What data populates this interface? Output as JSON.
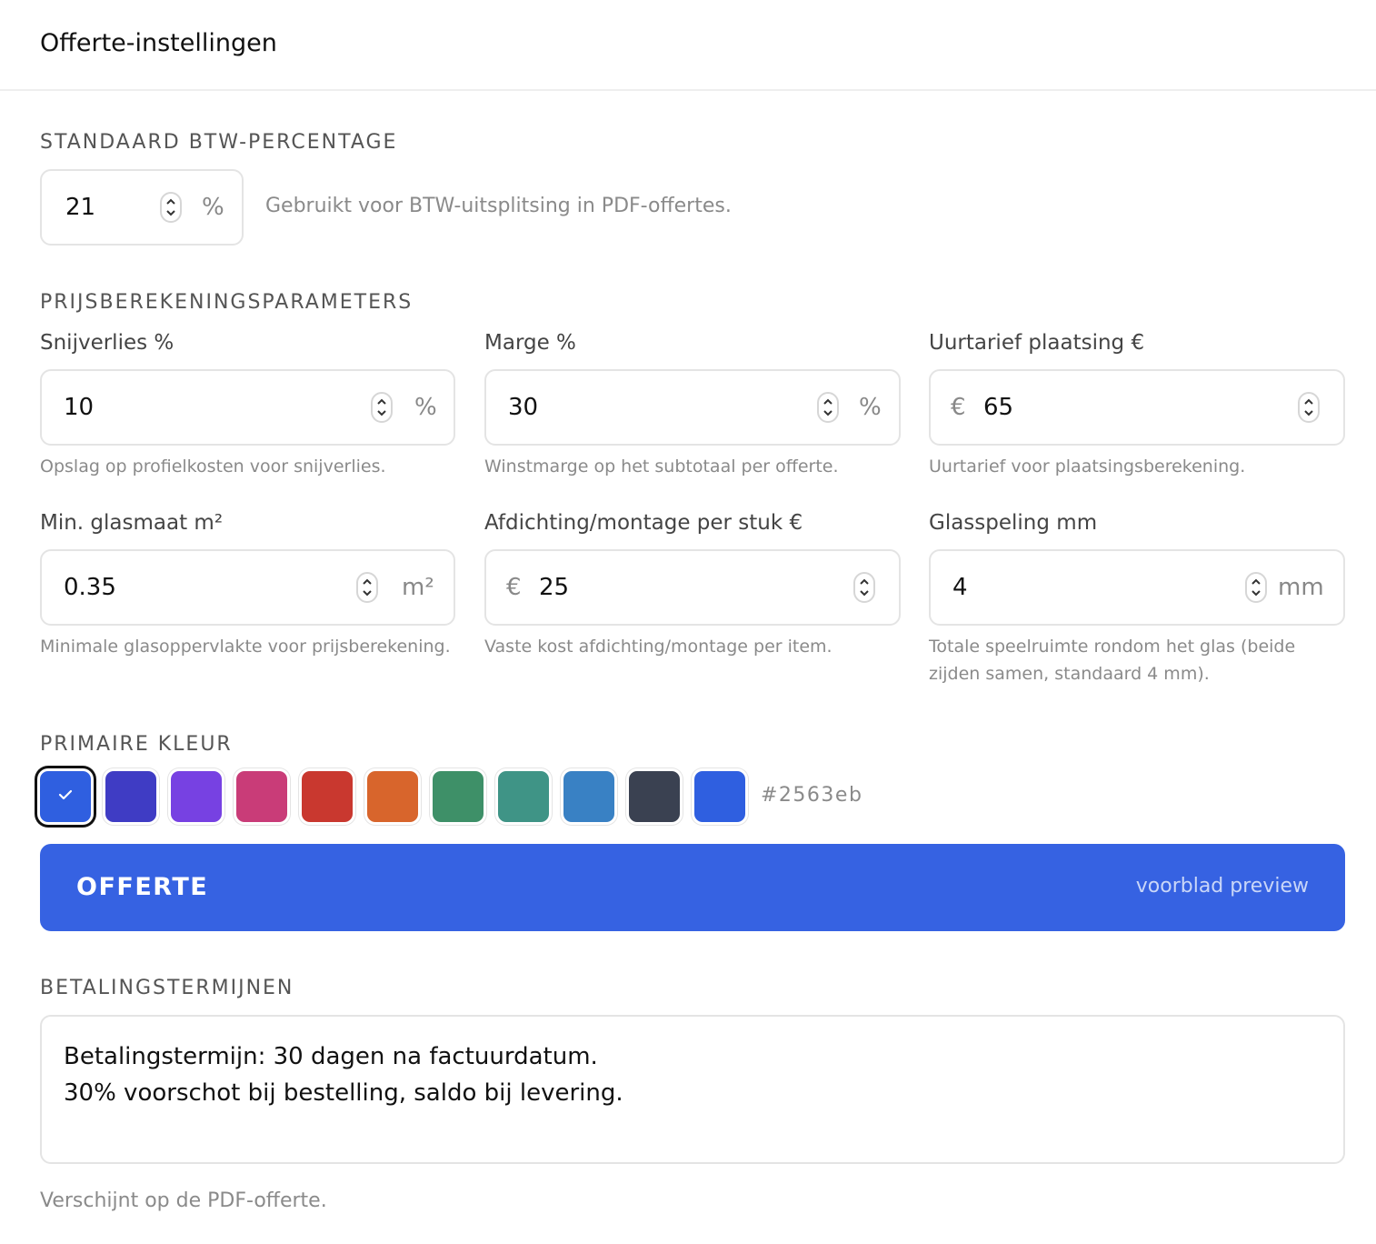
{
  "header": {
    "title": "Offerte-instellingen"
  },
  "btw": {
    "section_title": "STANDAARD BTW-PERCENTAGE",
    "value": "21",
    "suffix": "%",
    "hint": "Gebruikt voor BTW-uitsplitsing in PDF-offertes."
  },
  "pricing": {
    "section_title": "PRIJSBEREKENINGSPARAMETERS",
    "fields": [
      {
        "label": "Snijverlies %",
        "prefix": "",
        "value": "10",
        "suffix": "%",
        "hint": "Opslag op profielkosten voor snijverlies."
      },
      {
        "label": "Marge %",
        "prefix": "",
        "value": "30",
        "suffix": "%",
        "hint": "Winstmarge op het subtotaal per offerte."
      },
      {
        "label": "Uurtarief plaatsing €",
        "prefix": "€",
        "value": "65",
        "suffix": "",
        "hint": "Uurtarief voor plaatsingsberekening."
      },
      {
        "label": "Min. glasmaat m²",
        "prefix": "",
        "value": "0.35",
        "suffix": "m²",
        "hint": "Minimale glasoppervlakte voor prijsberekening."
      },
      {
        "label": "Afdichting/montage per stuk €",
        "prefix": "€",
        "value": "25",
        "suffix": "",
        "hint": "Vaste kost afdichting/montage per item."
      },
      {
        "label": "Glasspeling mm",
        "prefix": "",
        "value": "4",
        "suffix": "mm",
        "hint": "Totale speelruimte rondom het glas (beide zijden samen, standaard 4 mm)."
      }
    ]
  },
  "color": {
    "section_title": "PRIMAIRE KLEUR",
    "swatches": [
      "#2f5fe0",
      "#3f3cc4",
      "#7741e2",
      "#c93c78",
      "#c9382f",
      "#d8652c",
      "#3e9068",
      "#3f9486",
      "#3981c4",
      "#3a4151",
      "#2f5fe0"
    ],
    "selected_index": 0,
    "hex_value": "#2563eb"
  },
  "preview": {
    "title": "OFFERTE",
    "subtitle": "voorblad preview",
    "background": "#3662e2"
  },
  "payment": {
    "section_title": "BETALINGSTERMIJNEN",
    "text": "Betalingstermijn: 30 dagen na factuurdatum.\n30% voorschot bij bestelling, saldo bij levering.",
    "hint": "Verschijnt op de PDF-offerte."
  }
}
